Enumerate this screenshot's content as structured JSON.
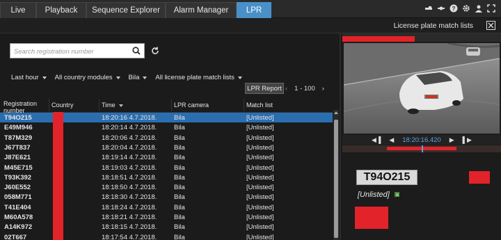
{
  "tabs": [
    {
      "label": "Live"
    },
    {
      "label": "Playback"
    },
    {
      "label": "Sequence Explorer"
    },
    {
      "label": "Alarm Manager"
    },
    {
      "label": "LPR"
    }
  ],
  "subbar": {
    "title": "License plate match lists"
  },
  "search": {
    "placeholder": "Search registration number"
  },
  "filters": [
    {
      "label": "Last hour"
    },
    {
      "label": "All country modules"
    },
    {
      "label": "Bila"
    },
    {
      "label": "All license plate match lists"
    }
  ],
  "report_button": "LPR Report",
  "pager": {
    "range": "1 - 100",
    "prev": "‹",
    "next": "›"
  },
  "table": {
    "headers": {
      "reg": "Registration number",
      "country": "Country",
      "time": "Time",
      "camera": "LPR camera",
      "match": "Match list"
    },
    "rows": [
      {
        "plate": "T94O215",
        "time": "18:20:16 4.7.2018.",
        "camera": "Bila",
        "match": "[Unlisted]"
      },
      {
        "plate": "E49M946",
        "time": "18:20:14 4.7.2018.",
        "camera": "Bila",
        "match": "[Unlisted]"
      },
      {
        "plate": "T87M329",
        "time": "18:20:06 4.7.2018.",
        "camera": "Bila",
        "match": "[Unlisted]"
      },
      {
        "plate": "J67T837",
        "time": "18:20:04 4.7.2018.",
        "camera": "Bila",
        "match": "[Unlisted]"
      },
      {
        "plate": "J87E621",
        "time": "18:19:14 4.7.2018.",
        "camera": "Bila",
        "match": "[Unlisted]"
      },
      {
        "plate": "M45E715",
        "time": "18:19:03 4.7.2018.",
        "camera": "Bila",
        "match": "[Unlisted]"
      },
      {
        "plate": "T93K392",
        "time": "18:18:51 4.7.2018.",
        "camera": "Bila",
        "match": "[Unlisted]"
      },
      {
        "plate": "J60E552",
        "time": "18:18:50 4.7.2018.",
        "camera": "Bila",
        "match": "[Unlisted]"
      },
      {
        "plate": "058M771",
        "time": "18:18:30 4.7.2018.",
        "camera": "Bila",
        "match": "[Unlisted]"
      },
      {
        "plate": "T41E404",
        "time": "18:18:24 4.7.2018.",
        "camera": "Bila",
        "match": "[Unlisted]"
      },
      {
        "plate": "M60A578",
        "time": "18:18:21 4.7.2018.",
        "camera": "Bila",
        "match": "[Unlisted]"
      },
      {
        "plate": "A14K972",
        "time": "18:18:15 4.7.2018.",
        "camera": "Bila",
        "match": "[Unlisted]"
      },
      {
        "plate": "02T667",
        "time": "18:17:54 4.7.2018.",
        "camera": "Bila",
        "match": "[Unlisted]"
      }
    ]
  },
  "video": {
    "timestamp": "18:20:16.420"
  },
  "detail": {
    "plate": "T94O215",
    "match": "[Unlisted]"
  },
  "colors": {
    "accent": "#4a90c8",
    "selected_row": "#2a6eb0",
    "red": "#e2232a"
  }
}
